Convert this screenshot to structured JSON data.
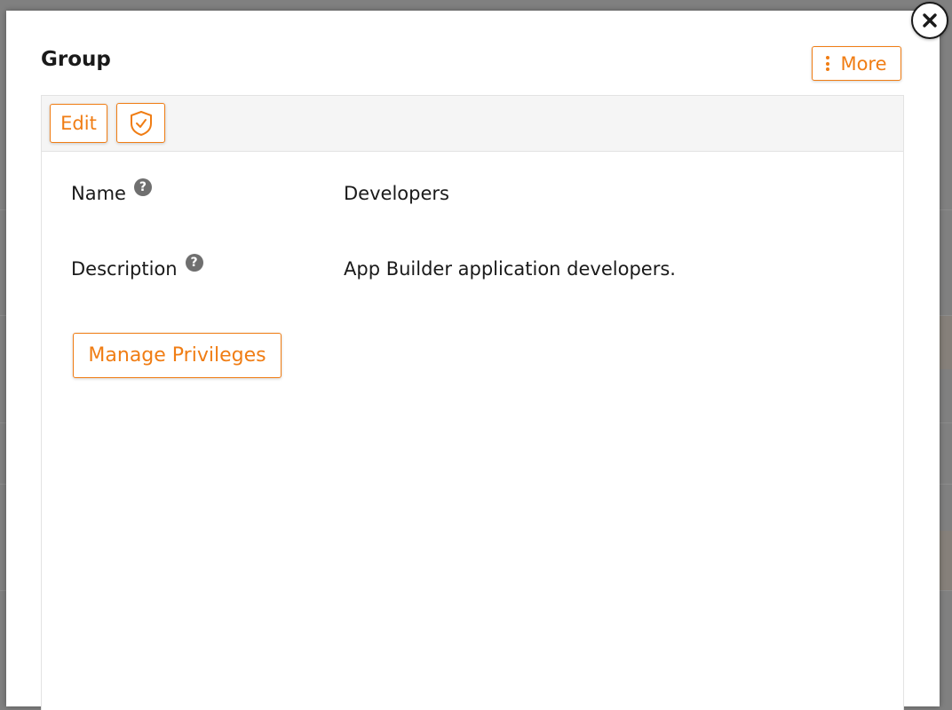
{
  "modal": {
    "title": "Group",
    "more_label": "More",
    "close_icon": "close-icon",
    "kebab_icon": "vertical-ellipsis-icon"
  },
  "toolbar": {
    "edit_label": "Edit",
    "shield_icon": "shield-check-icon"
  },
  "fields": [
    {
      "label": "Name",
      "value": "Developers",
      "help_icon": "question-circle-icon"
    },
    {
      "label": "Description",
      "value": "App Builder application developers.",
      "help_icon": "question-circle-icon"
    }
  ],
  "actions": {
    "manage_privileges_label": "Manage Privileges"
  },
  "colors": {
    "accent": "#f07d14",
    "overlay": "#808080",
    "panel_header": "#f5f5f5"
  }
}
